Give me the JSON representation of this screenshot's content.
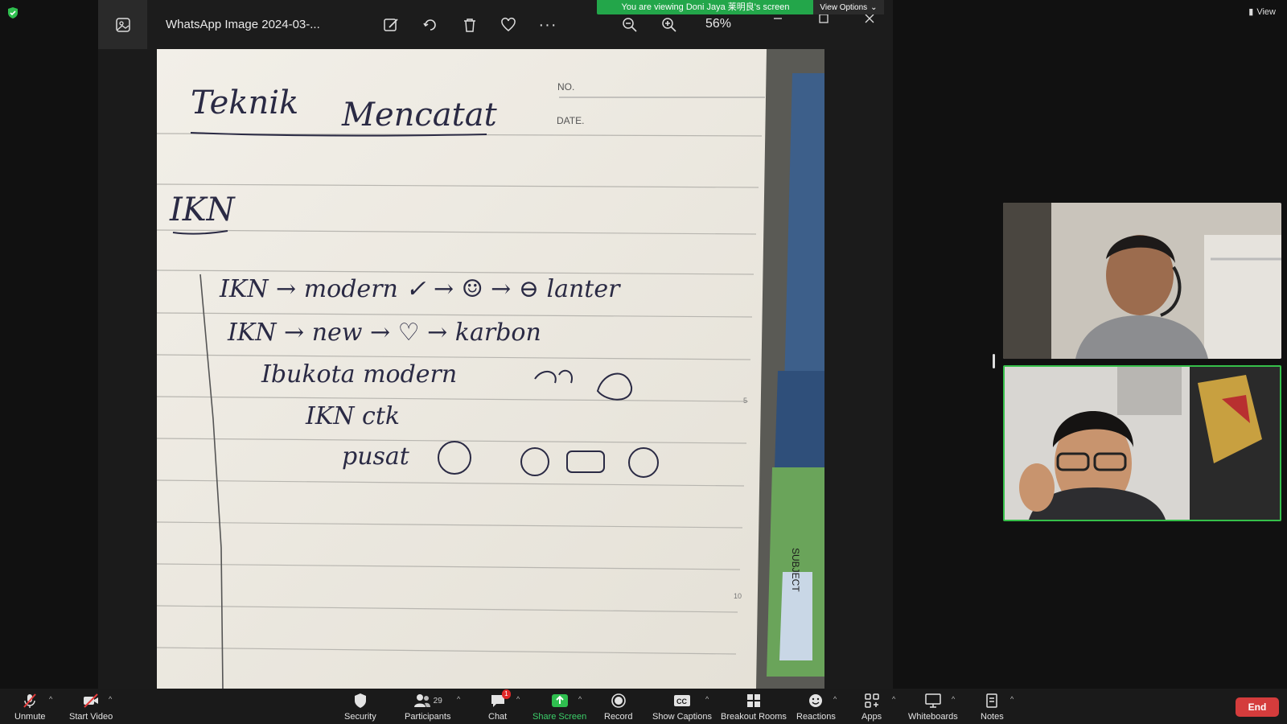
{
  "top": {
    "view_label": "View"
  },
  "banner": {
    "text": "You are viewing Doni Jaya 莱明良's screen",
    "view_options": "View Options"
  },
  "viewer": {
    "title": "WhatsApp Image 2024-03-...",
    "zoom": "56%"
  },
  "notebook": {
    "no_label": "NO.",
    "date_label": "DATE.",
    "heading_1": "Teknik",
    "heading_2": "Mencatat",
    "topic": "IKN",
    "lines": [
      "IKN → modern ✓ → ☺ → ⊖ lanter",
      "IKN → new → ♡ → karbon",
      "Ibukota modern",
      "IKN ctk",
      "pusat"
    ],
    "tab_subject": "SUBJECT",
    "margin_5": "5",
    "margin_10": "10"
  },
  "toolbar": {
    "unmute": "Unmute",
    "start_video": "Start Video",
    "security": "Security",
    "participants": "Participants",
    "participants_count": "29",
    "chat": "Chat",
    "chat_badge": "1",
    "share_screen": "Share Screen",
    "record": "Record",
    "show_captions": "Show Captions",
    "breakout_rooms": "Breakout Rooms",
    "reactions": "Reactions",
    "apps": "Apps",
    "whiteboards": "Whiteboards",
    "notes": "Notes",
    "end": "End"
  },
  "colors": {
    "accent_green": "#23a64a",
    "end_red": "#d43c3c",
    "active_border": "#36c04a"
  }
}
